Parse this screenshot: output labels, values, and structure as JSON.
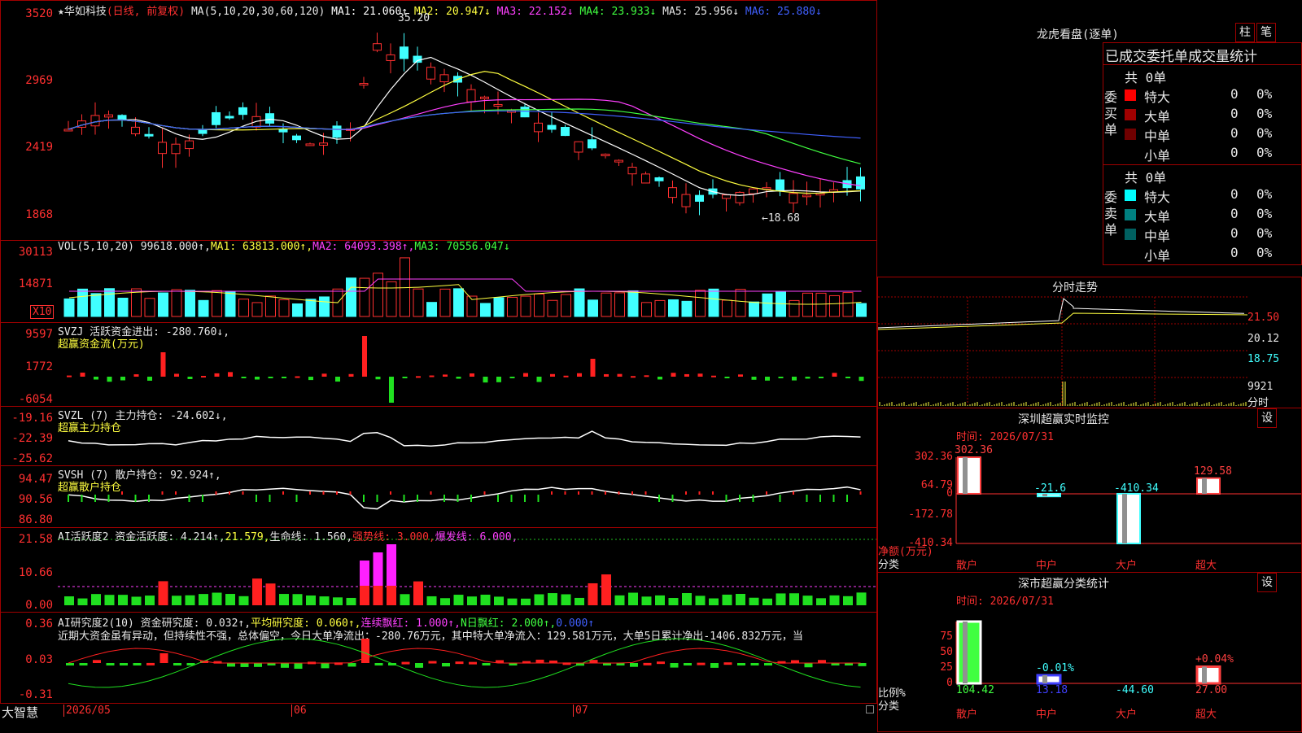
{
  "app_name": "大智慧",
  "stock": {
    "name": "★华如科技",
    "mode": "(日线, 前复权)"
  },
  "main": {
    "ma_label": "MA(5,10,20,30,60,120)",
    "ma": [
      {
        "label": "MA1: 21.060",
        "arrow": "↑",
        "color": "#ffffff"
      },
      {
        "label": "MA2: 20.947",
        "arrow": "↓",
        "color": "#ffff40"
      },
      {
        "label": "MA3: 22.152",
        "arrow": "↓",
        "color": "#ff40ff"
      },
      {
        "label": "MA4: 23.933",
        "arrow": "↓",
        "color": "#40ff40"
      },
      {
        "label": "MA5: 25.956",
        "arrow": "↓",
        "color": "#e8e8e8"
      },
      {
        "label": "MA6: 25.880",
        "arrow": "↓",
        "color": "#4060ff"
      }
    ],
    "y_ticks": [
      "3520",
      "2969",
      "2419",
      "1868"
    ],
    "high_label": "35.20",
    "low_label": "←18.68"
  },
  "vol": {
    "label": "VOL(5,10,20)",
    "value": "99618.000↑,",
    "ma1": "MA1: 63813.000↑,",
    "ma2": "MA2: 64093.398↑,",
    "ma3": "MA3: 70556.047↓",
    "y_ticks": [
      "30113",
      "14871"
    ],
    "unit": "X10"
  },
  "svzj": {
    "line1": "SVZJ  活跃资金进出: -280.760↓,",
    "line2": "超赢资金流(万元)",
    "y_ticks": [
      "9597",
      "1772",
      "-6054"
    ]
  },
  "svzl": {
    "line1": "SVZL (7) 主力持仓: -24.602↓,",
    "line2": "超赢主力持仓",
    "y_ticks": [
      "-19.16",
      "-22.39",
      "-25.62"
    ]
  },
  "svsh": {
    "line1": "SVSH (7) 散户持仓: 92.924↑,",
    "line2": "超赢散户持仓",
    "y_ticks": [
      "94.47",
      "90.56",
      "86.80"
    ]
  },
  "ai1": {
    "label": "AI活跃度2 资金活跃度: 4.214↑,",
    "v2": "21.579,",
    "v3": "生命线: 1.560,",
    "v4": "强势线: 3.000,",
    "v5": "爆发线: 6.000,",
    "y_ticks": [
      "21.58",
      "10.66",
      "0.00"
    ]
  },
  "ai2": {
    "label": "AI研究度2(10) 资金研究度: 0.032↑,",
    "v2": "平均研究度: 0.060↑,",
    "v3": "连续飘红: 1.000↑,",
    "v4": "N日飘红: 2.000↑,",
    "v5": "0.000↑",
    "comment": "近期大资金虽有异动，但持续性不强，总体偏空，今日大单净流出：-280.76万元，其中特大单净流入：129.581万元，大单5日累计净出-1406.832万元，当",
    "y_ticks": [
      "0.36",
      "0.03",
      "-0.31"
    ]
  },
  "x_dates": [
    "2026/05",
    "06",
    "07"
  ],
  "lhb": {
    "title": "龙虎看盘(逐单)",
    "btn1": "柱",
    "btn2": "笔",
    "header": "已成交委托单成交量统计",
    "buy": {
      "label": "委买单",
      "total": "共 0单",
      "rows": [
        {
          "name": "特大",
          "count": "0",
          "pct": "0%",
          "color": "#ff0000"
        },
        {
          "name": "大单",
          "count": "0",
          "pct": "0%",
          "color": "#a00000"
        },
        {
          "name": "中单",
          "count": "0",
          "pct": "0%",
          "color": "#700000"
        },
        {
          "name": "小单",
          "count": "0",
          "pct": "0%",
          "color": "#000000"
        }
      ]
    },
    "sell": {
      "label": "委卖单",
      "total": "共 0单",
      "rows": [
        {
          "name": "特大",
          "count": "0",
          "pct": "0%",
          "color": "#00ffff"
        },
        {
          "name": "大单",
          "count": "0",
          "pct": "0%",
          "color": "#008080"
        },
        {
          "name": "中单",
          "count": "0",
          "pct": "0%",
          "color": "#006060"
        },
        {
          "name": "小单",
          "count": "0",
          "pct": "0%",
          "color": "#000000"
        }
      ]
    }
  },
  "intraday": {
    "title": "分时走势",
    "prices": [
      "21.50",
      "20.12",
      "18.75"
    ],
    "vol": "9921",
    "tab": "分时"
  },
  "monitor": {
    "title": "深圳超赢实时监控",
    "settings": "设",
    "time": "时间: 2026/07/31",
    "y_ticks": [
      "302.36",
      "64.79",
      "0",
      "-172.78",
      "-410.34"
    ],
    "ylabel": "净额(万元)",
    "xlabel": "分类",
    "bars": [
      {
        "cat": "散户",
        "value": 302.36,
        "label": "302.36"
      },
      {
        "cat": "中户",
        "value": -21.6,
        "label": "-21.6"
      },
      {
        "cat": "大户",
        "value": -410.34,
        "label": "-410.34"
      },
      {
        "cat": "超大",
        "value": 129.58,
        "label": "129.58"
      }
    ]
  },
  "classify": {
    "title": "深市超赢分类统计",
    "settings": "设",
    "time": "时间: 2026/07/31",
    "y_ticks": [
      "75",
      "50",
      "25",
      "0"
    ],
    "ylabel": "比例%",
    "xlabel": "分类",
    "bars": [
      {
        "cat": "散户",
        "value": 104.42,
        "label": "104.42",
        "pct": ""
      },
      {
        "cat": "中户",
        "value": 13.18,
        "label": "13.18",
        "pct": "-0.01%"
      },
      {
        "cat": "大户",
        "value": -44.6,
        "label": "-44.60",
        "pct": ""
      },
      {
        "cat": "超大",
        "value": 27.0,
        "label": "27.00",
        "pct": "+0.04%"
      }
    ]
  }
}
